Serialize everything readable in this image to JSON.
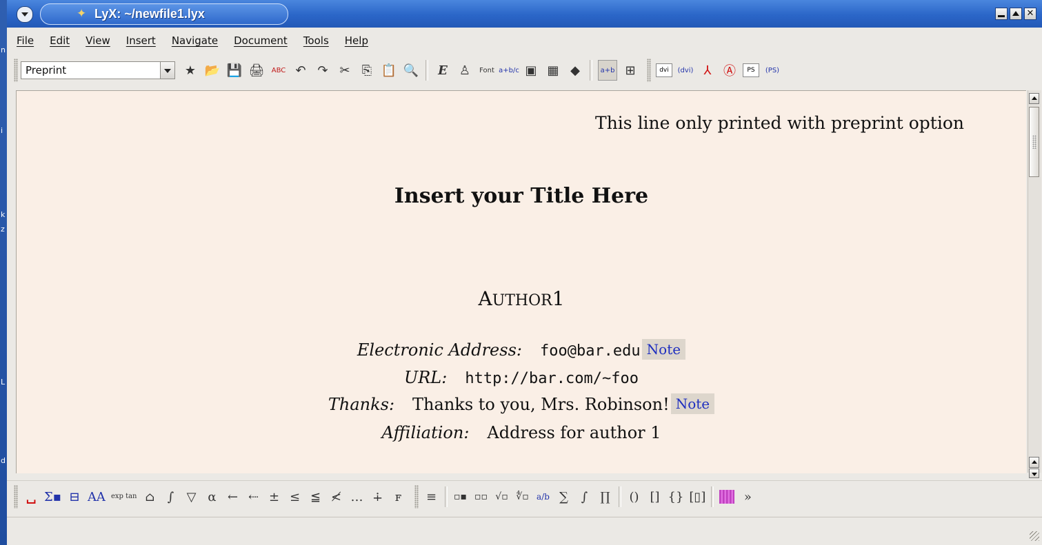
{
  "window": {
    "title": "LyX: ~/newfile1.lyx"
  },
  "desktop_strip": [
    "n",
    "i",
    "k",
    "z",
    "L",
    "d"
  ],
  "menu": [
    "File",
    "Edit",
    "View",
    "Insert",
    "Navigate",
    "Document",
    "Tools",
    "Help"
  ],
  "toolbar": {
    "layout_value": "Preprint",
    "buttons": [
      {
        "name": "new-document-icon",
        "glyph": "★"
      },
      {
        "name": "open-document-icon",
        "glyph": "📂"
      },
      {
        "name": "save-icon",
        "glyph": "💾"
      },
      {
        "name": "print-icon",
        "glyph": "🖨"
      },
      {
        "name": "spellcheck-icon",
        "glyph": "ABC"
      },
      {
        "name": "undo-icon",
        "glyph": "↶"
      },
      {
        "name": "redo-icon",
        "glyph": "↷"
      },
      {
        "name": "cut-icon",
        "glyph": "✂"
      },
      {
        "name": "copy-icon",
        "glyph": "⎘"
      },
      {
        "name": "paste-icon",
        "glyph": "📋"
      },
      {
        "name": "find-replace-icon",
        "glyph": "🔍"
      },
      {
        "name": "emphasize-icon",
        "glyph": "E"
      },
      {
        "name": "noun-icon",
        "glyph": "♙"
      },
      {
        "name": "font-icon",
        "glyph": "Font"
      },
      {
        "name": "insert-math-icon",
        "glyph": "a+b/c"
      },
      {
        "name": "insert-graphics-icon",
        "glyph": "▣"
      },
      {
        "name": "insert-table-icon",
        "glyph": "▦"
      },
      {
        "name": "table-of-contents-icon",
        "glyph": "◆"
      },
      {
        "name": "math-panel-toggle-icon",
        "glyph": "a+b"
      },
      {
        "name": "table-panel-toggle-icon",
        "glyph": "⊞"
      }
    ],
    "view_buttons": [
      {
        "name": "view-dvi-icon",
        "glyph": "dvi"
      },
      {
        "name": "update-dvi-icon",
        "glyph": "(dvi)"
      },
      {
        "name": "view-pdf-icon",
        "glyph": "⅄"
      },
      {
        "name": "update-pdf-icon",
        "glyph": "Ⓐ"
      },
      {
        "name": "view-ps-icon",
        "glyph": "PS"
      },
      {
        "name": "update-ps-icon",
        "glyph": "(PS)"
      }
    ]
  },
  "document": {
    "preprint_line": "This line only printed with preprint option",
    "title": "Insert your Title Here",
    "author_first": "A",
    "author_rest": "UTHOR",
    "author_num": "1",
    "email_label": "Electronic Address:",
    "email_value": "foo@bar.edu",
    "url_label": "URL:",
    "url_value": "http://bar.com/~foo",
    "thanks_label": "Thanks:",
    "thanks_value": "Thanks to you, Mrs. Robinson!",
    "affiliation_label": "Affiliation:",
    "affiliation_value": "Address for author 1",
    "note_label": "Note"
  },
  "mathbar": {
    "buttons": [
      {
        "name": "math-space-icon",
        "glyph": "␣"
      },
      {
        "name": "math-operators-icon",
        "glyph": "Σ▪"
      },
      {
        "name": "math-fraction-stack-icon",
        "glyph": "⊟"
      },
      {
        "name": "math-styles-icon",
        "glyph": "AA"
      },
      {
        "name": "math-functions-icon",
        "glyph": "exp tan"
      },
      {
        "name": "math-delimiters-icon",
        "glyph": "⌂"
      },
      {
        "name": "math-integral-bounds-icon",
        "glyph": "∫"
      },
      {
        "name": "math-nabla-icon",
        "glyph": "▽"
      },
      {
        "name": "math-greek-icon",
        "glyph": "α"
      },
      {
        "name": "math-arrows-icon",
        "glyph": "←"
      },
      {
        "name": "math-long-arrows-icon",
        "glyph": "⇠"
      },
      {
        "name": "math-operators-plusminus-icon",
        "glyph": "±"
      },
      {
        "name": "math-relations-icon",
        "glyph": "≤"
      },
      {
        "name": "math-relations2-icon",
        "glyph": "≦"
      },
      {
        "name": "math-negations-icon",
        "glyph": "≮"
      },
      {
        "name": "math-dots-icon",
        "glyph": "…"
      },
      {
        "name": "math-dot-plus-icon",
        "glyph": "∔"
      },
      {
        "name": "math-misc-icon",
        "glyph": "ꜰ"
      }
    ],
    "buttons2": [
      {
        "name": "math-display-icon",
        "glyph": "≡"
      },
      {
        "name": "math-subscript-icon",
        "glyph": "▫▪"
      },
      {
        "name": "math-superscript-icon",
        "glyph": "▫▫"
      },
      {
        "name": "math-sqrt-icon",
        "glyph": "√▫"
      },
      {
        "name": "math-root-icon",
        "glyph": "∜▫"
      },
      {
        "name": "math-frac-icon",
        "glyph": "a/b"
      },
      {
        "name": "math-sum-icon",
        "glyph": "∑"
      },
      {
        "name": "math-integral-icon",
        "glyph": "∫"
      },
      {
        "name": "math-product-icon",
        "glyph": "∏"
      },
      {
        "name": "math-parens-icon",
        "glyph": "()"
      },
      {
        "name": "math-brackets-icon",
        "glyph": "[]"
      },
      {
        "name": "math-braces-icon",
        "glyph": "{}"
      },
      {
        "name": "math-matrix-delim-icon",
        "glyph": "[▯]"
      },
      {
        "name": "math-matrix-icon",
        "glyph": ""
      },
      {
        "name": "overflow-chevron-icon",
        "glyph": "»"
      }
    ]
  }
}
